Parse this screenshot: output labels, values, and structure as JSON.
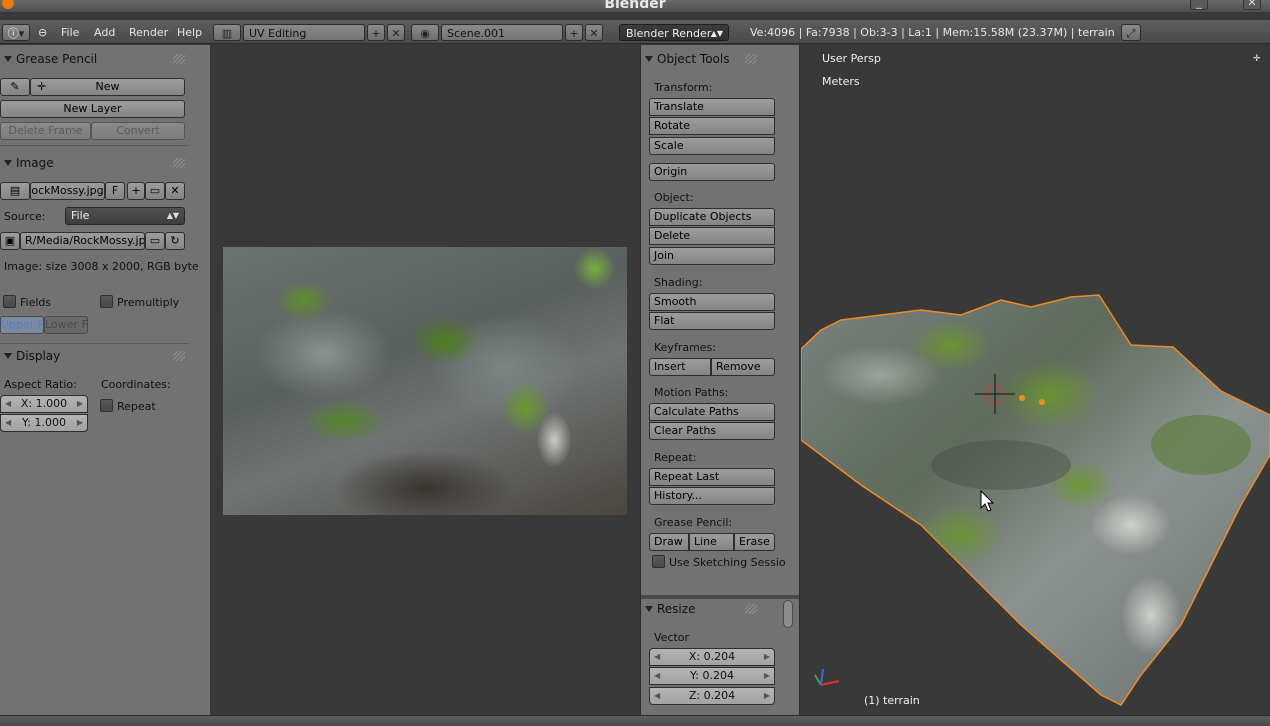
{
  "window": {
    "title": "Blender"
  },
  "header": {
    "menus": [
      "File",
      "Add",
      "Render",
      "Help"
    ],
    "layout": "UV Editing",
    "scene": "Scene.001",
    "engine": "Blender Render",
    "stats": "Ve:4096 | Fa:7938 | Ob:3-3 | La:1 | Mem:15.58M (23.37M) | terrain"
  },
  "grease_pencil": {
    "title": "Grease Pencil",
    "new_label": "New",
    "new_layer_label": "New Layer",
    "delete_frame_label": "Delete Frame",
    "convert_label": "Convert"
  },
  "image": {
    "title": "Image",
    "name": "ockMossy.jpg",
    "fake_user": "F",
    "source_label": "Source:",
    "source_value": "File",
    "path": "R/Media/RockMossy.jpg",
    "info": "Image: size 3008 x 2000, RGB byte",
    "fields_label": "Fields",
    "premultiply_label": "Premultiply",
    "upper_field": "Upper Fi",
    "lower_field": "Lower Fi"
  },
  "display": {
    "title": "Display",
    "aspect_label": "Aspect Ratio:",
    "coordinates_label": "Coordinates:",
    "aspect_x": "X: 1.000",
    "aspect_y": "Y: 1.000",
    "repeat_label": "Repeat"
  },
  "object_tools": {
    "title": "Object Tools",
    "transform_label": "Transform:",
    "translate": "Translate",
    "rotate": "Rotate",
    "scale": "Scale",
    "origin": "Origin",
    "object_label": "Object:",
    "duplicate": "Duplicate Objects",
    "delete": "Delete",
    "join": "Join",
    "shading_label": "Shading:",
    "smooth": "Smooth",
    "flat": "Flat",
    "keyframes_label": "Keyframes:",
    "insert": "Insert",
    "remove": "Remove",
    "motion_label": "Motion Paths:",
    "calc_paths": "Calculate Paths",
    "clear_paths": "Clear Paths",
    "repeat_label": "Repeat:",
    "repeat_last": "Repeat Last",
    "history": "History...",
    "gp_label": "Grease Pencil:",
    "draw": "Draw",
    "line": "Line",
    "erase": "Erase",
    "sketch": "Use Sketching Sessio"
  },
  "resize": {
    "title": "Resize",
    "vector_label": "Vector",
    "x": "X: 0.204",
    "y": "Y: 0.204",
    "z": "Z: 0.204"
  },
  "viewport": {
    "view_name": "User Persp",
    "units": "Meters",
    "object_label": "(1) terrain"
  },
  "icons": [
    "blender-logo-icon",
    "info-icon",
    "screen-layout-icon",
    "scene-icon",
    "pencil-icon",
    "image-icon",
    "folder-icon",
    "refresh-icon",
    "fullscreen-icon"
  ],
  "colors": {
    "selection_outline": "#f08a22",
    "panel_bg": "#727272",
    "viewport_bg": "#393939"
  }
}
